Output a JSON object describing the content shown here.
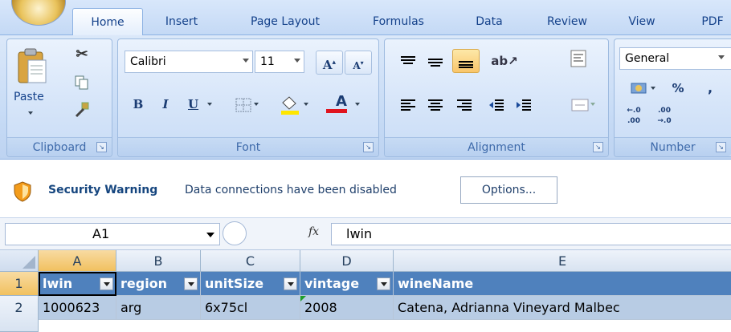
{
  "tabs": [
    {
      "label": "Home",
      "active": true
    },
    {
      "label": "Insert"
    },
    {
      "label": "Page Layout"
    },
    {
      "label": "Formulas"
    },
    {
      "label": "Data"
    },
    {
      "label": "Review"
    },
    {
      "label": "View"
    },
    {
      "label": "PDF"
    }
  ],
  "ribbon": {
    "clipboard": {
      "label": "Clipboard",
      "paste": "Paste"
    },
    "font": {
      "label": "Font",
      "name": "Calibri",
      "size": "11",
      "bold": "B",
      "italic": "I",
      "underline": "U",
      "grow": "A",
      "shrink": "A",
      "color_letter": "A"
    },
    "alignment": {
      "label": "Alignment"
    },
    "number": {
      "label": "Number",
      "format": "General",
      "percent": "%",
      "comma": ",",
      "inc_decimal": "←.0 .00",
      "dec_decimal": ".00 →.0"
    }
  },
  "security": {
    "title": "Security Warning",
    "message": "Data connections have been disabled",
    "options_label": "Options..."
  },
  "formula_bar": {
    "name_box": "A1",
    "fx": "fx",
    "formula": "lwin"
  },
  "grid": {
    "columns": [
      "A",
      "B",
      "C",
      "D",
      "E"
    ],
    "rows": [
      "1",
      "2"
    ],
    "header_row": [
      "lwin",
      "region",
      "unitSize",
      "vintage",
      "wineName"
    ],
    "data_row": [
      "1000623",
      "arg",
      "6x75cl",
      "2008",
      "Catena, Adrianna Vineyard Malbec"
    ]
  },
  "colors": {
    "table_header": "#4f81bd",
    "table_row": "#b8cce4",
    "accent": "#15428b"
  }
}
